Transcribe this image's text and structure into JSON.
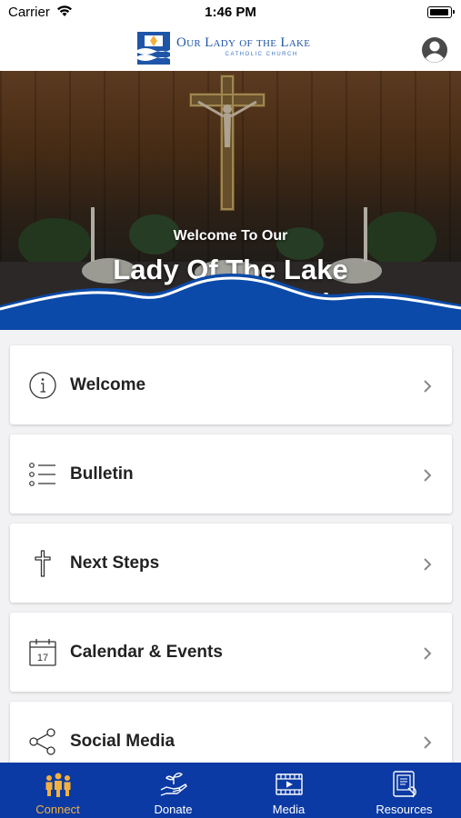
{
  "status_bar": {
    "carrier": "Carrier",
    "time": "1:46 PM"
  },
  "header": {
    "logo_title": "Our Lady of the Lake",
    "logo_subtitle": "CATHOLIC CHURCH"
  },
  "hero": {
    "subtitle": "Welcome To Our",
    "title_line1": "Lady Of The Lake",
    "title_line2": "Catholic Church"
  },
  "menu": [
    {
      "label": "Welcome",
      "icon": "info-icon"
    },
    {
      "label": "Bulletin",
      "icon": "list-icon"
    },
    {
      "label": "Next Steps",
      "icon": "cross-icon"
    },
    {
      "label": "Calendar & Events",
      "icon": "calendar-icon",
      "calendar_day": "17"
    },
    {
      "label": "Social Media",
      "icon": "share-icon"
    }
  ],
  "tabs": [
    {
      "label": "Connect",
      "icon": "people-icon",
      "active": true
    },
    {
      "label": "Donate",
      "icon": "hand-plant-icon",
      "active": false
    },
    {
      "label": "Media",
      "icon": "video-icon",
      "active": false
    },
    {
      "label": "Resources",
      "icon": "tablet-book-icon",
      "active": false
    }
  ],
  "colors": {
    "brand_blue": "#0b3aa4",
    "active_tab": "#f2b13d",
    "logo_blue": "#1f55a8"
  }
}
